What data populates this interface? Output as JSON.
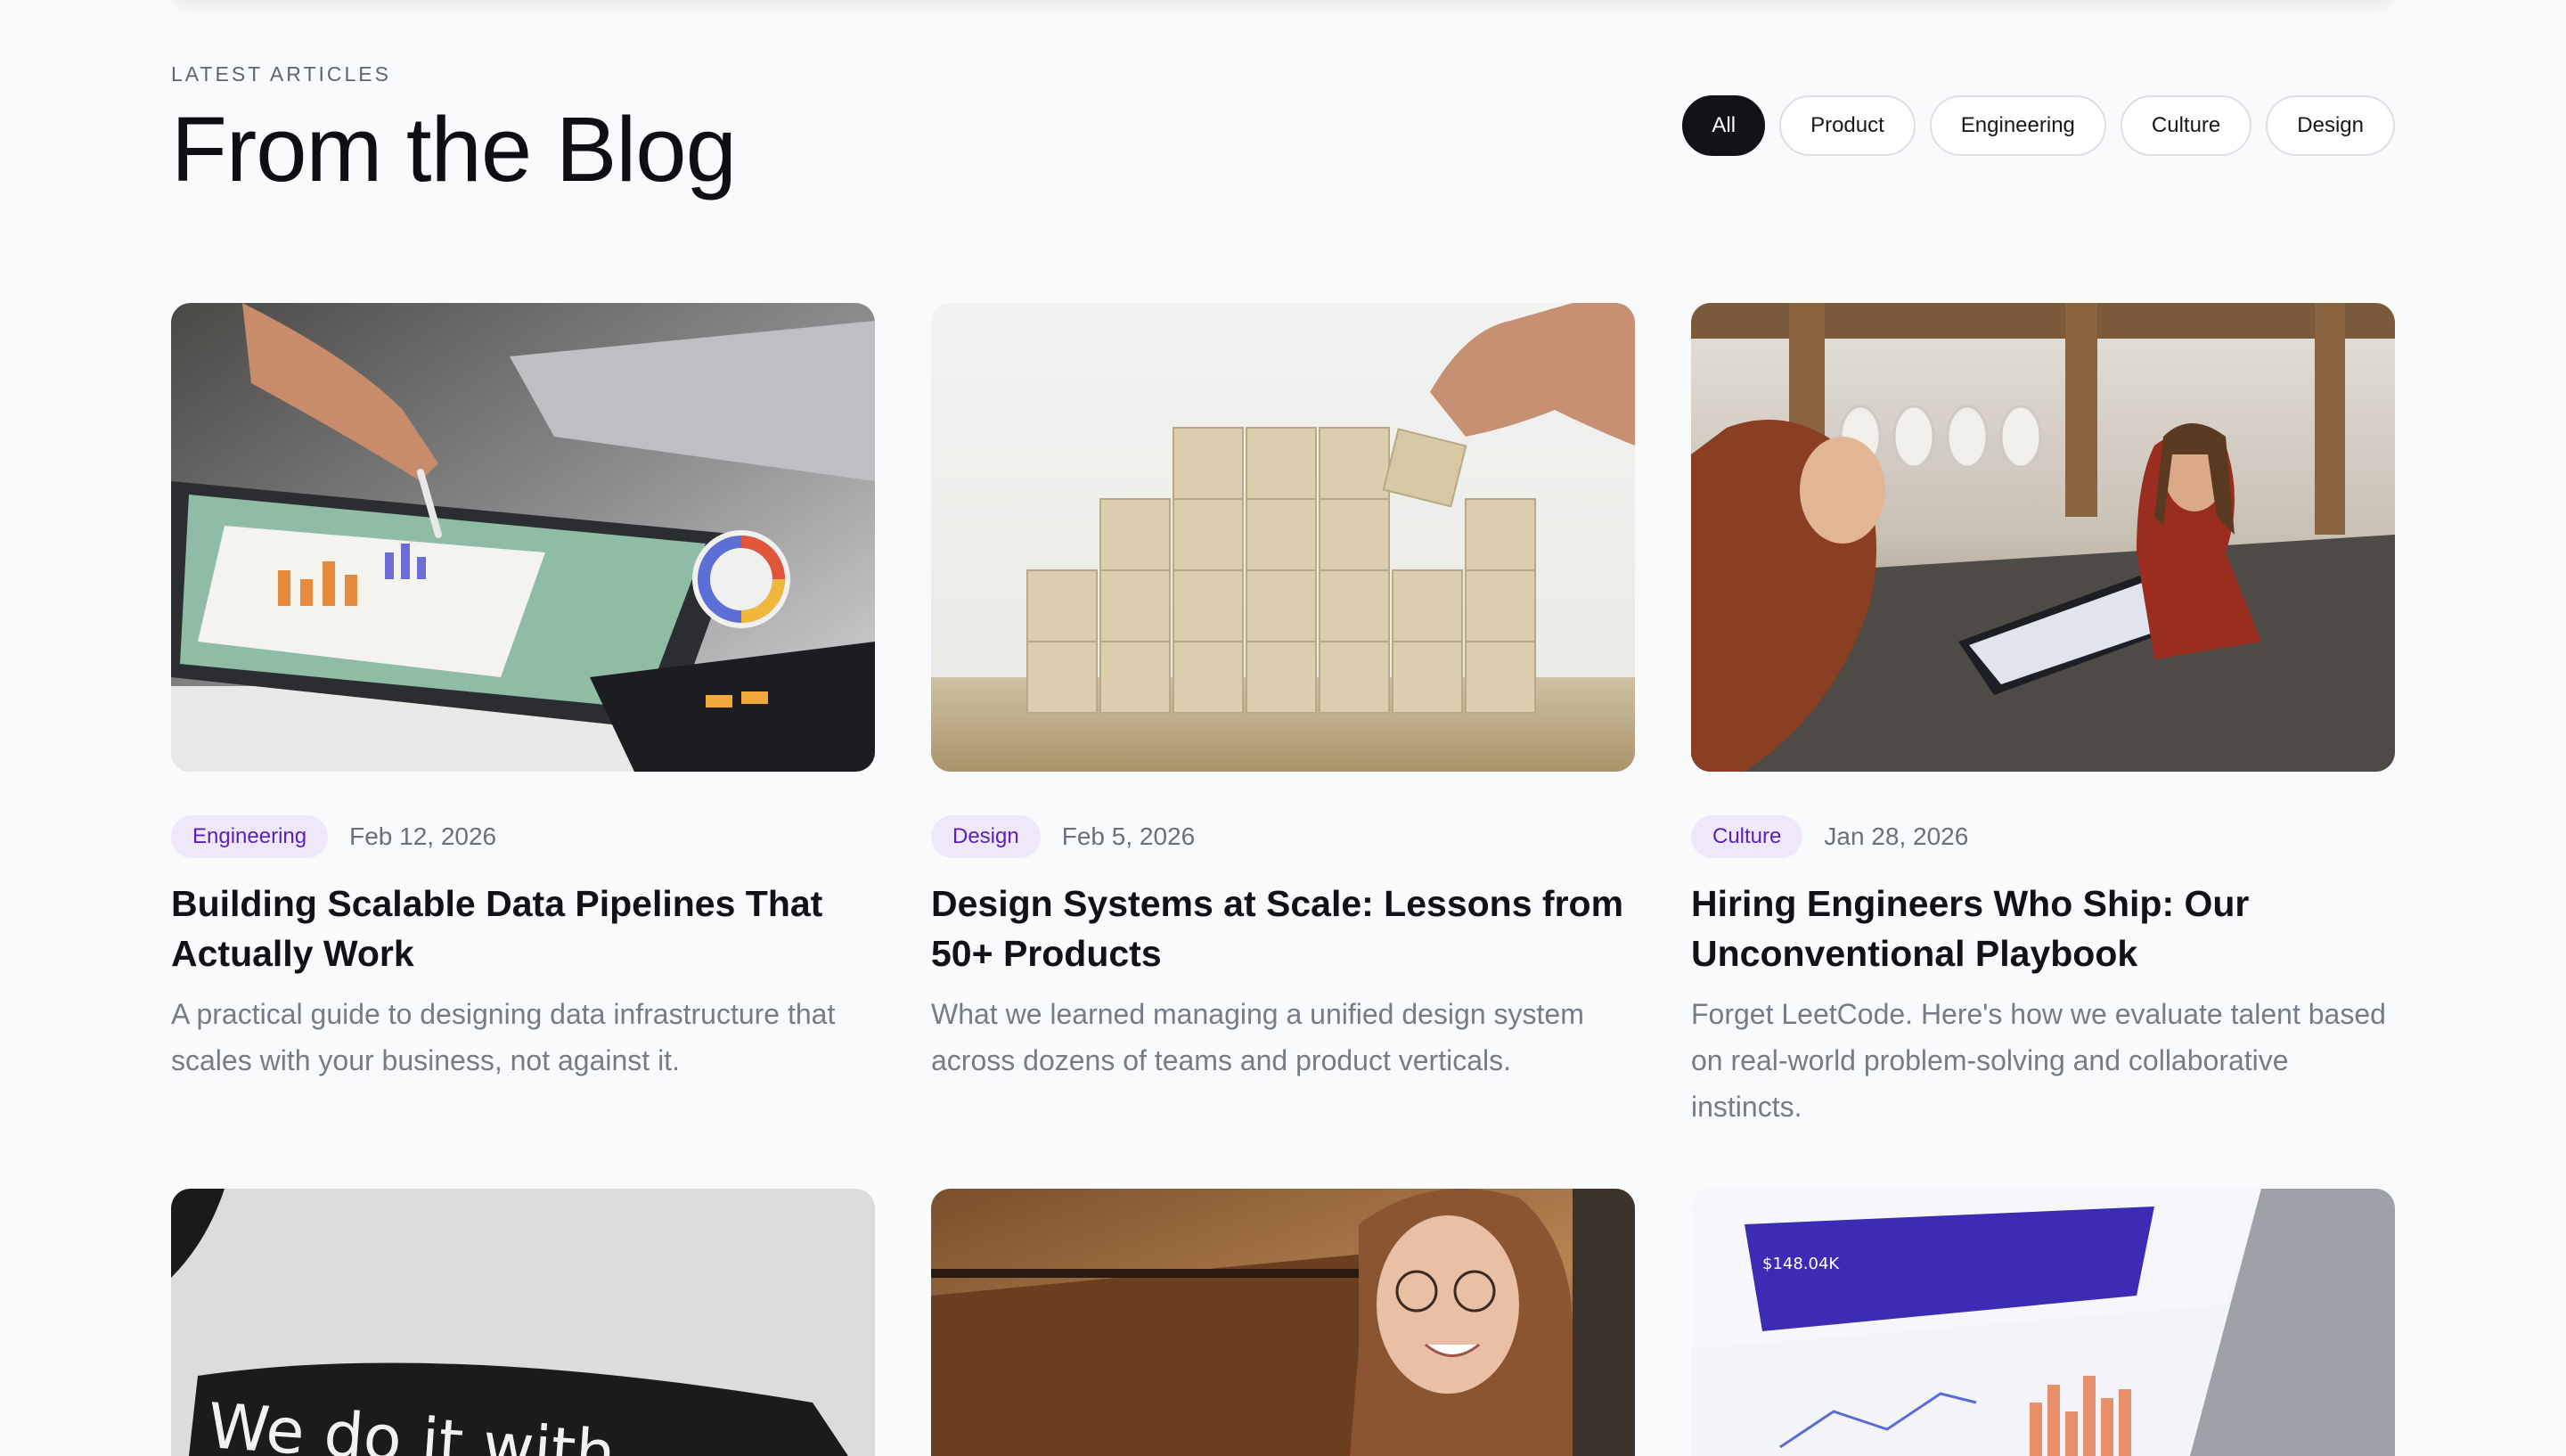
{
  "header": {
    "eyebrow": "LATEST ARTICLES",
    "title": "From the Blog"
  },
  "filters": [
    {
      "label": "All",
      "active": true
    },
    {
      "label": "Product",
      "active": false
    },
    {
      "label": "Engineering",
      "active": false
    },
    {
      "label": "Culture",
      "active": false
    },
    {
      "label": "Design",
      "active": false
    }
  ],
  "articles": [
    {
      "tag": "Engineering",
      "date": "Feb 12, 2026",
      "title": "Building Scalable Data Pipelines That Actually Work",
      "excerpt": "A practical guide to designing data infrastructure that scales with your business, not against it.",
      "image": "tablet-charts-photo"
    },
    {
      "tag": "Design",
      "date": "Feb 5, 2026",
      "title": "Design Systems at Scale: Lessons from 50+ Products",
      "excerpt": "What we learned managing a unified design system across dozens of teams and product verticals.",
      "image": "wooden-blocks-photo"
    },
    {
      "tag": "Culture",
      "date": "Jan 28, 2026",
      "title": "Hiring Engineers Who Ship: Our Unconventional Playbook",
      "excerpt": "Forget LeetCode. Here's how we evaluate talent based on real-world problem-solving and collaborative instincts.",
      "image": "office-meeting-photo"
    }
  ],
  "row2": [
    {
      "image": "tshirt-photo",
      "overlay_text": "We do it with"
    },
    {
      "image": "smiling-woman-photo"
    },
    {
      "image": "dashboard-laptop-photo",
      "overlay_text": "$148.04K"
    }
  ],
  "colors": {
    "background": "#f9fafc",
    "chip_active": "#111317",
    "tag_bg": "#efe8fb",
    "tag_text": "#5b21b6"
  }
}
